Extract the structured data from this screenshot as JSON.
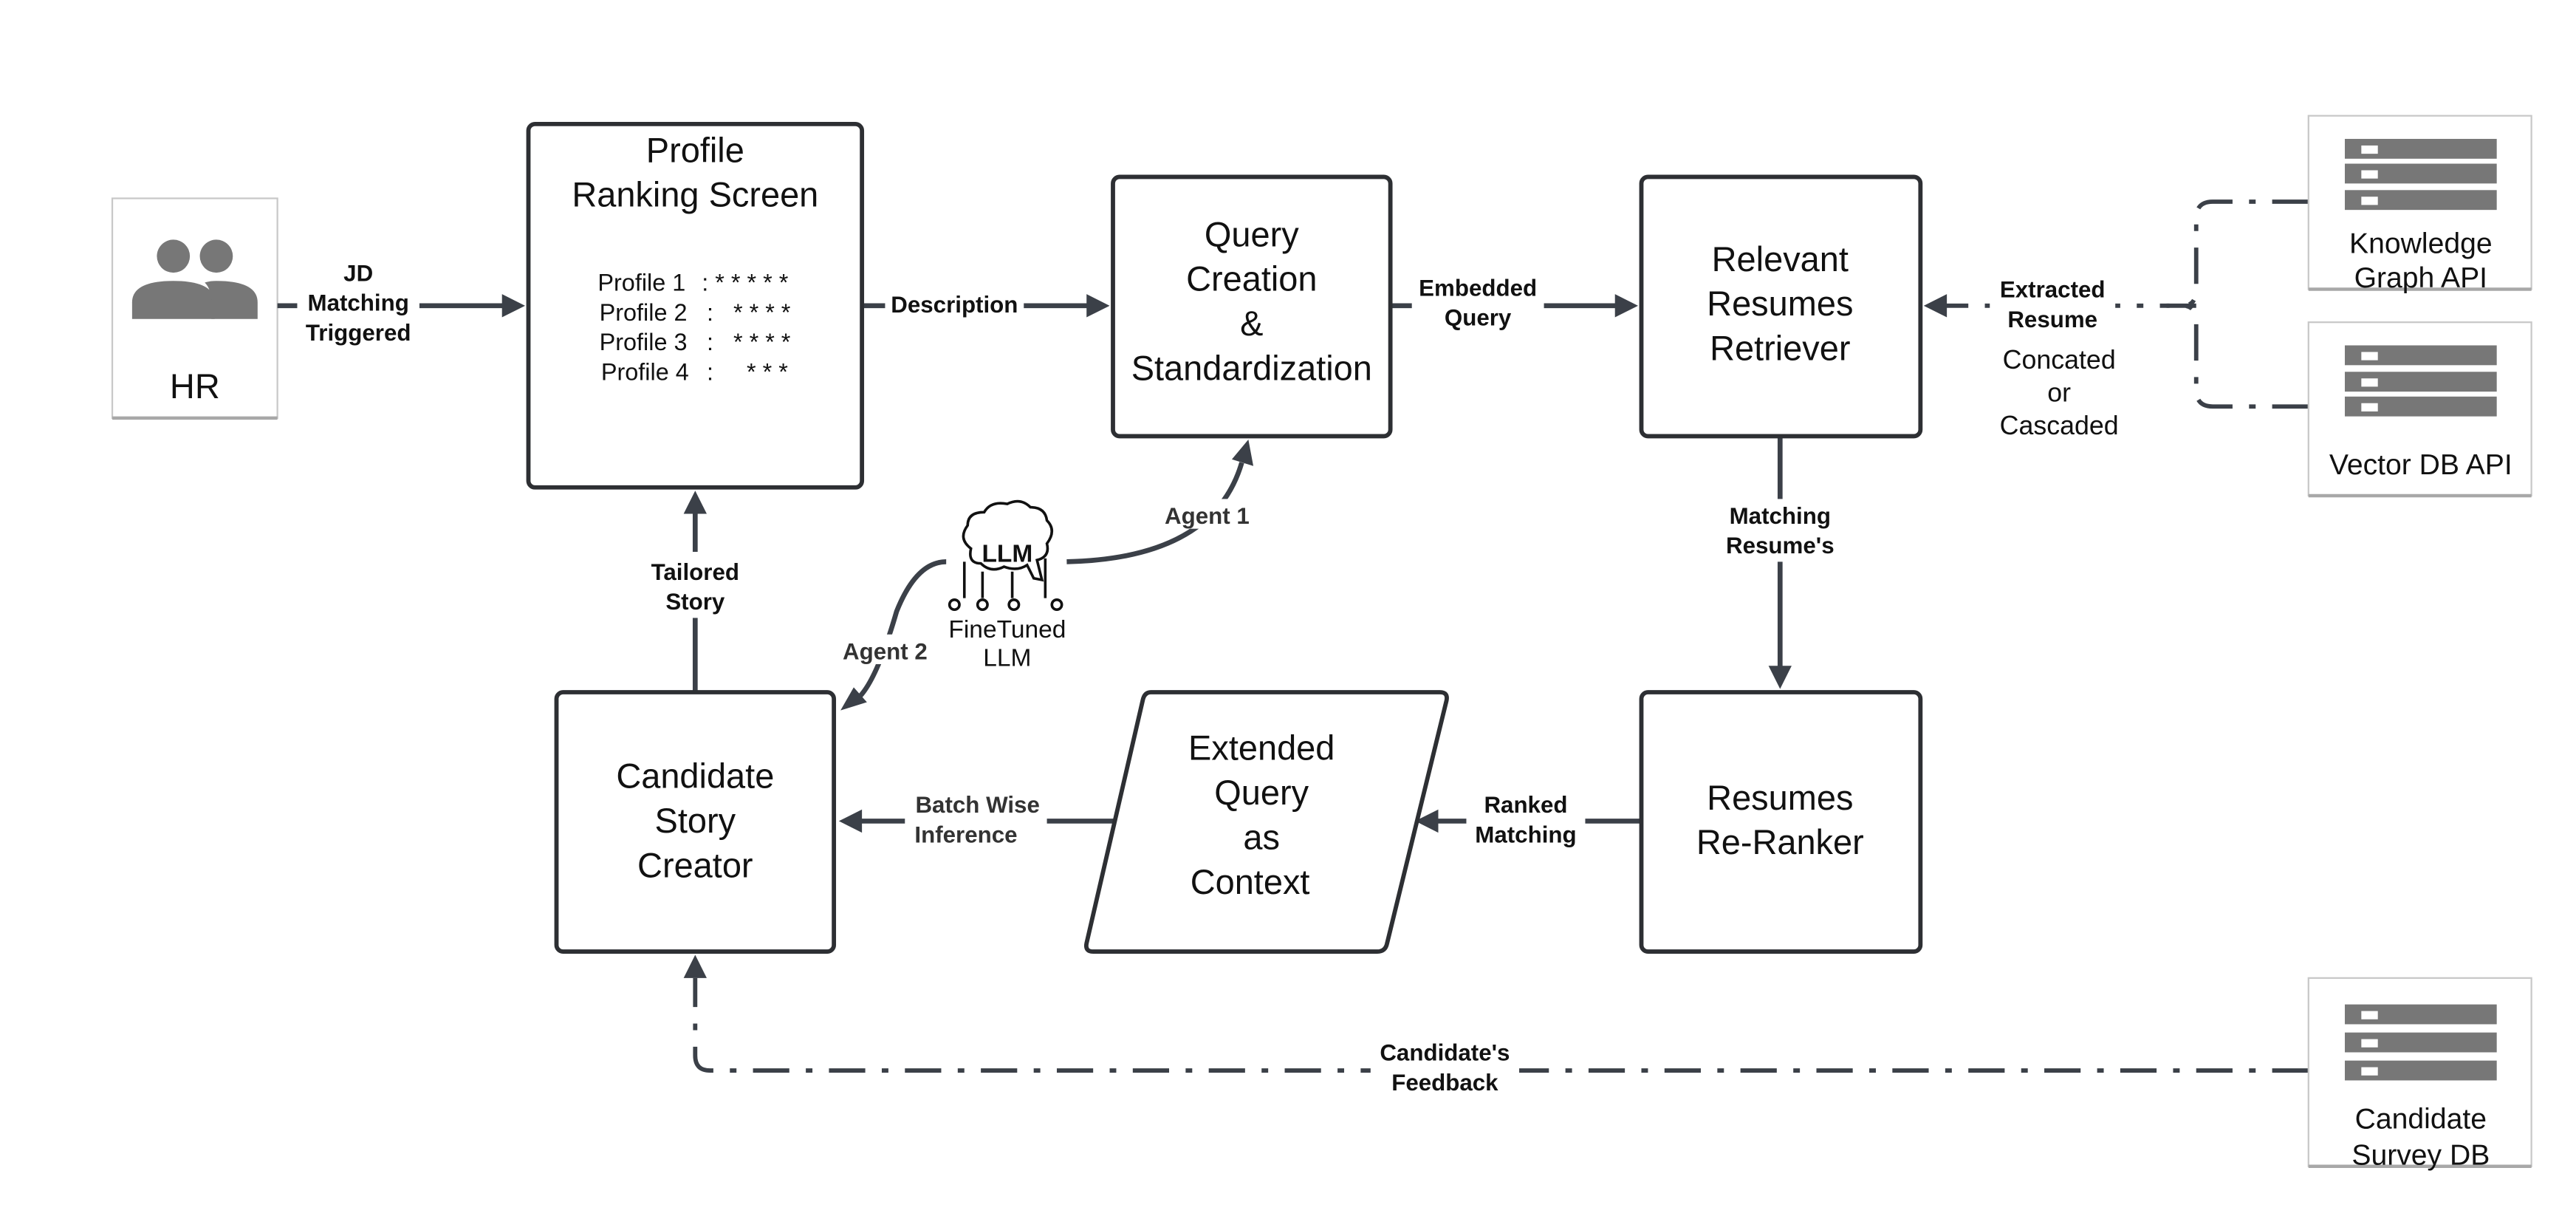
{
  "colors": {
    "line": "#3b4048",
    "box_stroke": "#2d2f33",
    "db_icon": "#777777"
  },
  "hr": {
    "label": "HR",
    "icon": "people-icon"
  },
  "edges": {
    "jd": [
      "JD",
      "Matching",
      "Triggered"
    ],
    "description": "Description",
    "embedded": [
      "Embedded",
      "Query"
    ],
    "extracted": [
      "Extracted",
      "Resume"
    ],
    "concated": [
      "Concated",
      "or",
      "Cascaded"
    ],
    "matching": [
      "Matching",
      "Resume's"
    ],
    "ranked": [
      "Ranked",
      "Matching"
    ],
    "batch": [
      "Batch Wise",
      "Inference"
    ],
    "tailored": [
      "Tailored",
      "Story"
    ],
    "agent1": "Agent 1",
    "agent2": "Agent 2",
    "feedback": [
      "Candidate's",
      "Feedback"
    ]
  },
  "profile_screen": {
    "title": [
      "Profile",
      "Ranking Screen"
    ],
    "profiles": [
      {
        "name": "Profile 1",
        "rating": ": * * * * *",
        "stars": 5
      },
      {
        "name": "Profile 2",
        "rating": ":   * * * *",
        "stars": 4
      },
      {
        "name": "Profile 3",
        "rating": ":   * * * *",
        "stars": 4
      },
      {
        "name": "Profile 4",
        "rating": ":     * * *",
        "stars": 3
      }
    ]
  },
  "query_box": [
    "Query",
    "Creation",
    "&",
    "Standardization"
  ],
  "retriever_box": [
    "Relevant",
    "Resumes",
    "Retriever"
  ],
  "reranker_box": [
    "Resumes",
    "Re-Ranker"
  ],
  "extended_box": [
    "Extended",
    "Query",
    "as",
    "Context"
  ],
  "candidate_box": [
    "Candidate",
    "Story",
    "Creator"
  ],
  "llm": {
    "icon_text": "LLM",
    "caption": [
      "FineTuned",
      "LLM"
    ],
    "icon": "brain-icon"
  },
  "databases": {
    "knowledge_graph": [
      "Knowledge",
      "Graph API"
    ],
    "vector_db": [
      "Vector DB API"
    ],
    "survey_db": [
      "Candidate",
      "Survey DB"
    ]
  }
}
